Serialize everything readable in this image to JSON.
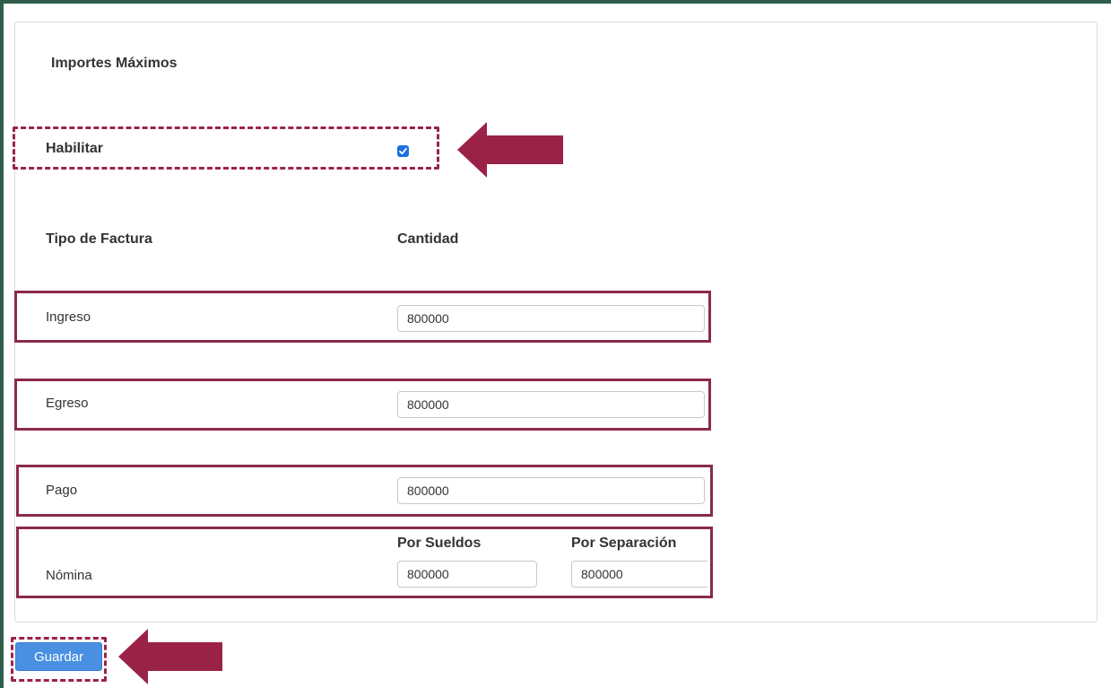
{
  "section": {
    "title": "Importes Máximos"
  },
  "enable": {
    "label": "Habilitar",
    "checked": true
  },
  "table": {
    "col_type": "Tipo de Factura",
    "col_amount": "Cantidad",
    "rows": [
      {
        "label": "Ingreso",
        "value": "800000"
      },
      {
        "label": "Egreso",
        "value": "800000"
      },
      {
        "label": "Pago",
        "value": "800000"
      }
    ],
    "nomina": {
      "label": "Nómina",
      "sueldos_label": "Por Sueldos",
      "sueldos_value": "800000",
      "separacion_label": "Por Separación",
      "separacion_value": "800000"
    }
  },
  "actions": {
    "save_label": "Guardar"
  },
  "colors": {
    "accent": "#9b2247",
    "button": "#4a90e2",
    "frame": "#2e5e4a"
  }
}
